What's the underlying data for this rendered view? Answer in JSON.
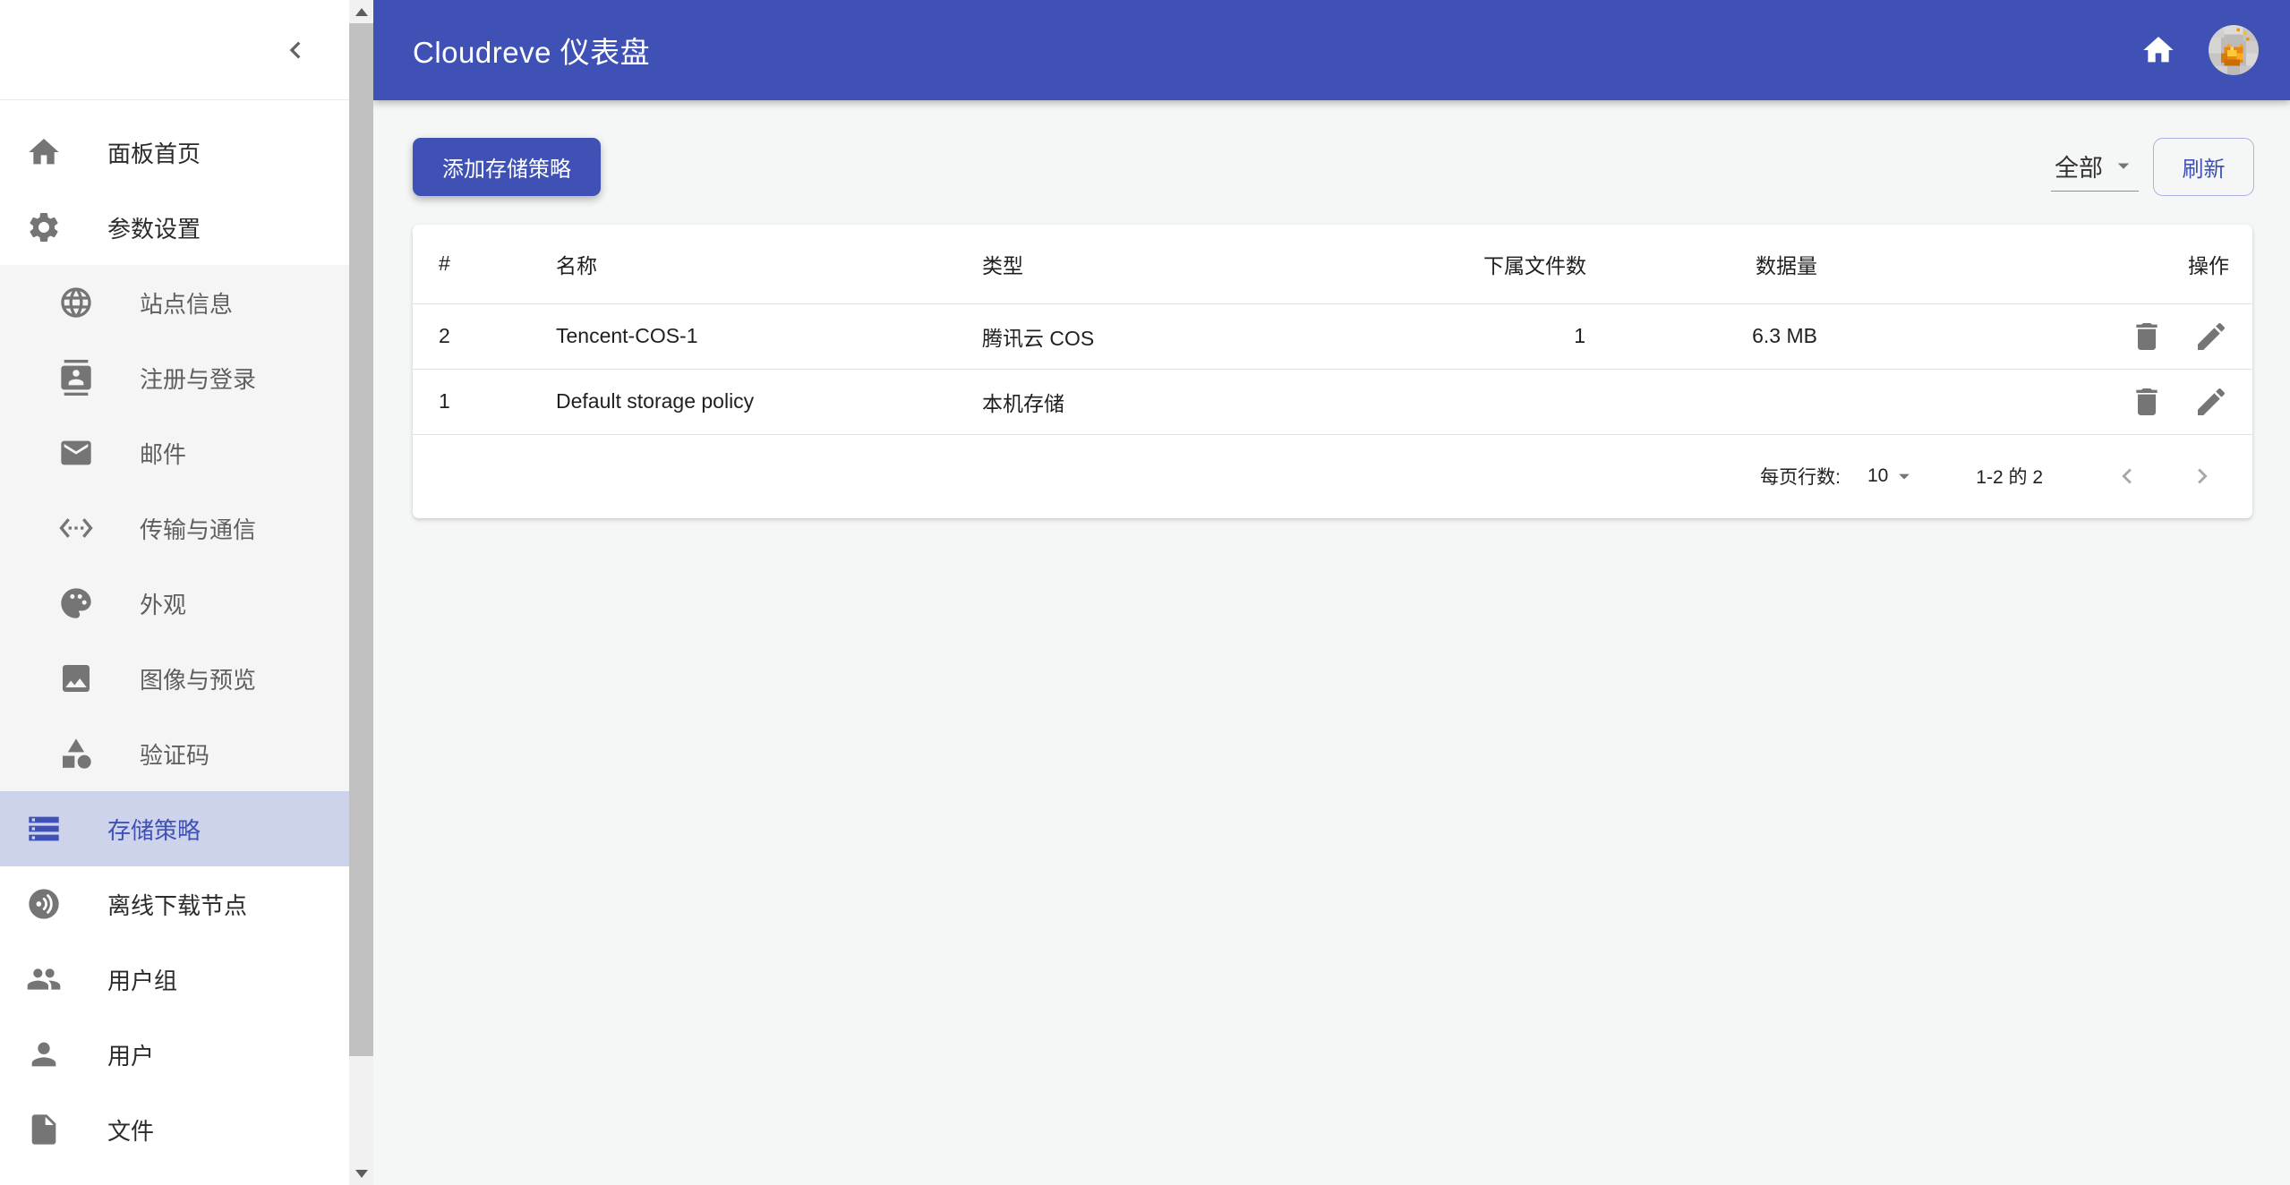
{
  "colors": {
    "primary": "#3f51b5",
    "selected_bg": "#ced3ec",
    "main_bg": "#f5f6f6",
    "icon_grey": "#757575"
  },
  "app_bar": {
    "title": "Cloudreve 仪表盘",
    "home_icon": "home-icon",
    "avatar_icon": "avatar-image"
  },
  "sidebar": {
    "collapse_icon": "chevron-left-icon",
    "items": [
      {
        "label": "面板首页",
        "icon": "home-icon",
        "sub": false,
        "selected": false
      },
      {
        "label": "参数设置",
        "icon": "gear-icon",
        "sub": false,
        "selected": false
      },
      {
        "label": "站点信息",
        "icon": "globe-icon",
        "sub": true,
        "selected": false
      },
      {
        "label": "注册与登录",
        "icon": "contact-card-icon",
        "sub": true,
        "selected": false
      },
      {
        "label": "邮件",
        "icon": "mail-icon",
        "sub": true,
        "selected": false
      },
      {
        "label": "传输与通信",
        "icon": "ethernet-icon",
        "sub": true,
        "selected": false
      },
      {
        "label": "外观",
        "icon": "palette-icon",
        "sub": true,
        "selected": false
      },
      {
        "label": "图像与预览",
        "icon": "image-icon",
        "sub": true,
        "selected": false
      },
      {
        "label": "验证码",
        "icon": "captcha-shapes-icon",
        "sub": true,
        "selected": false
      },
      {
        "label": "存储策略",
        "icon": "storage-icon",
        "sub": false,
        "selected": true
      },
      {
        "label": "离线下载节点",
        "icon": "download-node-icon",
        "sub": false,
        "selected": false
      },
      {
        "label": "用户组",
        "icon": "user-group-icon",
        "sub": false,
        "selected": false
      },
      {
        "label": "用户",
        "icon": "user-icon",
        "sub": false,
        "selected": false
      },
      {
        "label": "文件",
        "icon": "file-icon",
        "sub": false,
        "selected": false
      }
    ]
  },
  "toolbar": {
    "add_button": "添加存储策略",
    "filter_value": "全部",
    "refresh_label": "刷新"
  },
  "table": {
    "columns": [
      "#",
      "名称",
      "类型",
      "下属文件数",
      "数据量",
      "操作"
    ],
    "rows": [
      {
        "num": "2",
        "name": "Tencent-COS-1",
        "type": "腾讯云 COS",
        "files": "1",
        "size": "6.3 MB"
      },
      {
        "num": "1",
        "name": "Default storage policy",
        "type": "本机存储",
        "files": "",
        "size": ""
      }
    ],
    "row_actions": [
      "delete-icon",
      "edit-icon"
    ],
    "pagination": {
      "rows_per_page_label": "每页行数:",
      "rows_per_page": "10",
      "range": "1-2 的 2"
    }
  }
}
